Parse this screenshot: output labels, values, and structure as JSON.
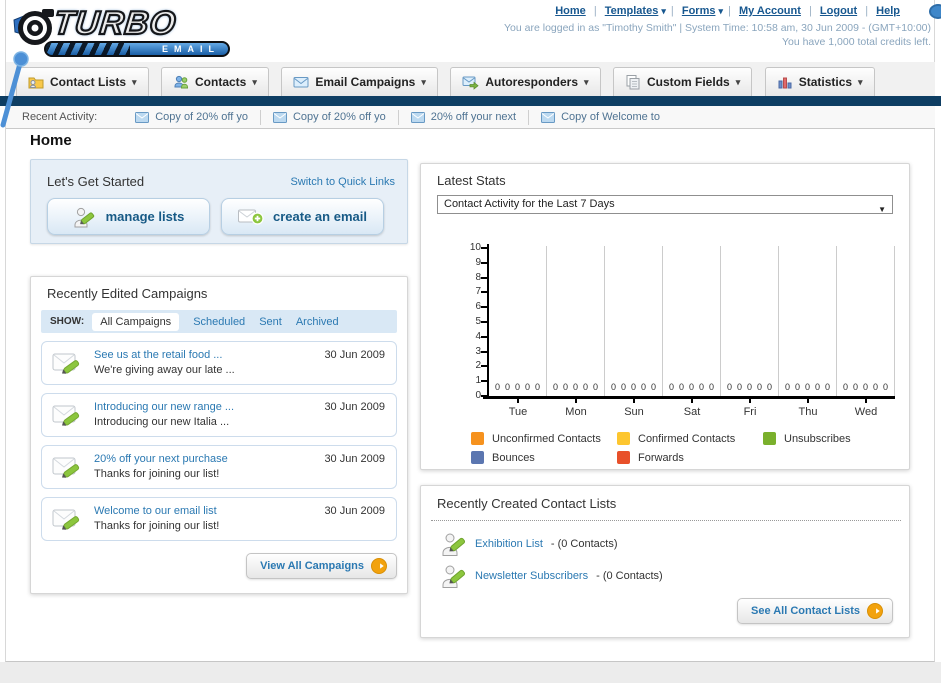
{
  "header": {
    "logo_title": "TURBO",
    "logo_subtitle": "EMAIL",
    "nav": {
      "home": "Home",
      "templates": "Templates",
      "forms": "Forms",
      "my_account": "My Account",
      "logout": "Logout",
      "help": "Help",
      "separator": "|"
    },
    "login_line": "You are logged in as \"Timothy Smith\" | System Time: 10:58 am, 30 Jun 2009 - (GMT+10:00)",
    "credits_line": "You have 1,000 total credits left."
  },
  "tabs": {
    "contact_lists": "Contact Lists",
    "contacts": "Contacts",
    "email_campaigns": "Email Campaigns",
    "autoresponders": "Autoresponders",
    "custom_fields": "Custom Fields",
    "statistics": "Statistics"
  },
  "recent_activity": {
    "label": "Recent Activity:",
    "items": [
      {
        "title": "Copy of 20% off yo"
      },
      {
        "title": "Copy of 20% off yo"
      },
      {
        "title": "20% off your next"
      },
      {
        "title": "Copy of Welcome to"
      }
    ]
  },
  "page_title": "Home",
  "get_started": {
    "title": "Let's Get Started",
    "switch_link": "Switch to Quick Links",
    "manage_lists_label": "manage lists",
    "create_email_label": "create an email"
  },
  "campaigns": {
    "title": "Recently Edited Campaigns",
    "show_label": "SHOW:",
    "filters": {
      "all": "All Campaigns",
      "scheduled": "Scheduled",
      "sent": "Sent",
      "archived": "Archived"
    },
    "items": [
      {
        "title": "See us at the retail food ...",
        "subtitle": "We're giving away our late ...",
        "date": "30 Jun 2009"
      },
      {
        "title": "Introducing our new range ...",
        "subtitle": "Introducing our new Italia ...",
        "date": "30 Jun 2009"
      },
      {
        "title": "20% off your next purchase",
        "subtitle": "Thanks for joining our list!",
        "date": "30 Jun 2009"
      },
      {
        "title": "Welcome to our email list",
        "subtitle": "Thanks for joining our list!",
        "date": "30 Jun 2009"
      }
    ],
    "view_all_label": "View All Campaigns"
  },
  "stats": {
    "title": "Latest Stats",
    "dropdown_value": "Contact Activity for the Last 7 Days",
    "chart_data": {
      "type": "bar",
      "categories": [
        "Tue",
        "Mon",
        "Sun",
        "Sat",
        "Fri",
        "Thu",
        "Wed"
      ],
      "series": [
        {
          "name": "Unconfirmed Contacts",
          "color": "#f6921e",
          "values": [
            0,
            0,
            0,
            0,
            0,
            0,
            0
          ]
        },
        {
          "name": "Confirmed Contacts",
          "color": "#fdc62f",
          "values": [
            0,
            0,
            0,
            0,
            0,
            0,
            0
          ]
        },
        {
          "name": "Unsubscribes",
          "color": "#7ab02c",
          "values": [
            0,
            0,
            0,
            0,
            0,
            0,
            0
          ]
        },
        {
          "name": "Bounces",
          "color": "#5b76b0",
          "values": [
            0,
            0,
            0,
            0,
            0,
            0,
            0
          ]
        },
        {
          "name": "Forwards",
          "color": "#e8502a",
          "values": [
            0,
            0,
            0,
            0,
            0,
            0,
            0
          ]
        }
      ],
      "ylim": [
        0,
        10
      ],
      "ytick_step": 1,
      "grid": "vertical-only",
      "legend_position": "bottom"
    }
  },
  "contact_lists": {
    "title": "Recently Created Contact Lists",
    "items": [
      {
        "name": "Exhibition List",
        "detail": "- (0 Contacts)"
      },
      {
        "name": "Newsletter Subscribers",
        "detail": "- (0 Contacts)"
      }
    ],
    "see_all_label": "See All Contact Lists"
  }
}
